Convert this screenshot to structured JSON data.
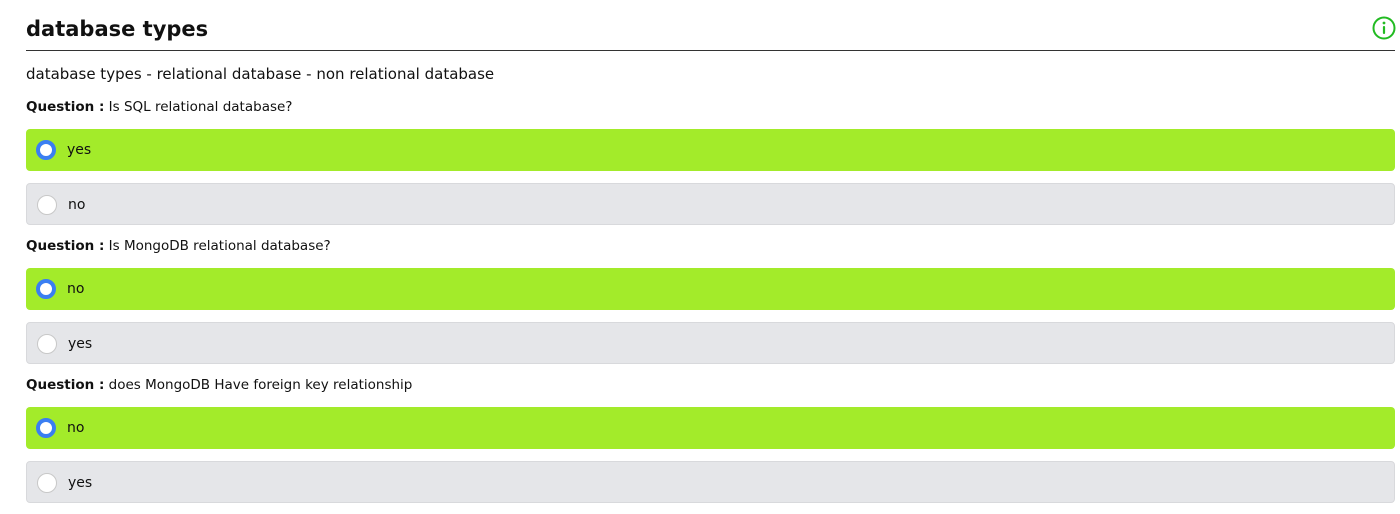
{
  "header": {
    "title": "database types",
    "info_icon": "info-circle-icon",
    "info_icon_color": "#22bb22"
  },
  "description": "database types - relational database - non relational database",
  "colors": {
    "selected_option_bg": "#a3eb2a",
    "unselected_option_bg": "#e5e6e9",
    "radio_accent": "#3a7ef2"
  },
  "questions": [
    {
      "prefix": "Question :",
      "text": "Is SQL relational database?",
      "options": [
        {
          "label": "yes",
          "selected": true
        },
        {
          "label": "no",
          "selected": false
        }
      ]
    },
    {
      "prefix": "Question :",
      "text": "Is MongoDB relational database?",
      "options": [
        {
          "label": "no",
          "selected": true
        },
        {
          "label": "yes",
          "selected": false
        }
      ]
    },
    {
      "prefix": "Question :",
      "text": "does MongoDB Have foreign key relationship",
      "options": [
        {
          "label": "no",
          "selected": true
        },
        {
          "label": "yes",
          "selected": false
        }
      ]
    }
  ]
}
